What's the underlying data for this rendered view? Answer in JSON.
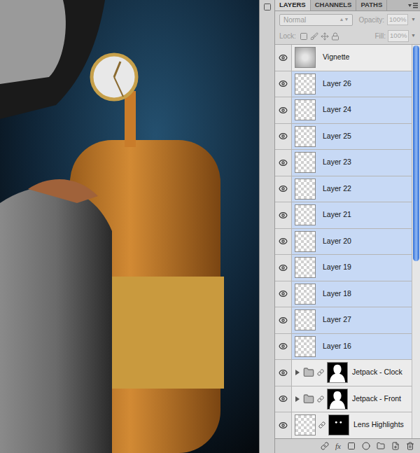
{
  "tabs": [
    {
      "label": "LAYERS",
      "selected": true
    },
    {
      "label": "CHANNELS",
      "selected": false
    },
    {
      "label": "PATHS",
      "selected": false
    }
  ],
  "blend_mode": {
    "value": "Normal",
    "disabled": true
  },
  "opacity": {
    "label": "Opacity:",
    "value": "100%",
    "disabled": true
  },
  "lock": {
    "label": "Lock:"
  },
  "fill": {
    "label": "Fill:",
    "value": "100%",
    "disabled": true
  },
  "layers": [
    {
      "name": "Vignette",
      "kind": "layer",
      "selected": false,
      "visible": true
    },
    {
      "name": "Layer 26",
      "kind": "layer",
      "selected": true,
      "visible": true
    },
    {
      "name": "Layer 24",
      "kind": "layer",
      "selected": true,
      "visible": true
    },
    {
      "name": "Layer 25",
      "kind": "layer",
      "selected": true,
      "visible": true
    },
    {
      "name": "Layer 23",
      "kind": "layer",
      "selected": true,
      "visible": true
    },
    {
      "name": "Layer 22",
      "kind": "layer",
      "selected": true,
      "visible": true
    },
    {
      "name": "Layer 21",
      "kind": "layer",
      "selected": true,
      "visible": true
    },
    {
      "name": "Layer 20",
      "kind": "layer",
      "selected": true,
      "visible": true
    },
    {
      "name": "Layer 19",
      "kind": "layer",
      "selected": true,
      "visible": true
    },
    {
      "name": "Layer 18",
      "kind": "layer",
      "selected": true,
      "visible": true
    },
    {
      "name": "Layer 27",
      "kind": "layer",
      "selected": true,
      "visible": true
    },
    {
      "name": "Layer 16",
      "kind": "layer",
      "selected": true,
      "visible": true
    },
    {
      "name": "Jetpack - Clock",
      "kind": "group",
      "selected": false,
      "visible": true,
      "expanded": false
    },
    {
      "name": "Jetpack - Front",
      "kind": "group",
      "selected": false,
      "visible": true,
      "expanded": false
    },
    {
      "name": "Lens Highlights",
      "kind": "masked",
      "selected": false,
      "visible": true
    }
  ],
  "scrollbar": {
    "level": 0.55
  },
  "toolbar": {
    "fx_label": "fx"
  }
}
